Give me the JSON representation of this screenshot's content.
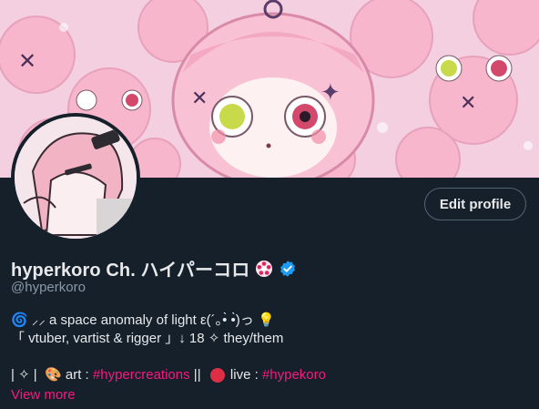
{
  "profile": {
    "display_name": "hyperkoro Ch. ハイパーコロ",
    "handle": "@hyperkoro",
    "edit_button": "Edit profile",
    "verified": true,
    "accent_color": "#1d9bf0"
  },
  "bio": {
    "line1_prefix": "🌀 ",
    "line1_text": "⸝⸝ a space anomaly of light ε(´｡•̀ •̀)っ 💡",
    "line2_text": "「 vtuber, vartist & rigger 」↓ 18 ✧ they/them",
    "line3_prefix": "| ✧ |  🎨 art : ",
    "line3_hashtag1": "#hypercreations",
    "line3_sep": " ||  ",
    "line3_live": "live : ",
    "line3_hashtag2": "#hypekoro",
    "view_more": "View more"
  },
  "colors": {
    "background": "#15202b",
    "link": "#f91880",
    "secondary_text": "#8b98a5"
  },
  "icons": [
    "badge-flower-icon",
    "verified-check-icon",
    "red-circle-icon"
  ]
}
